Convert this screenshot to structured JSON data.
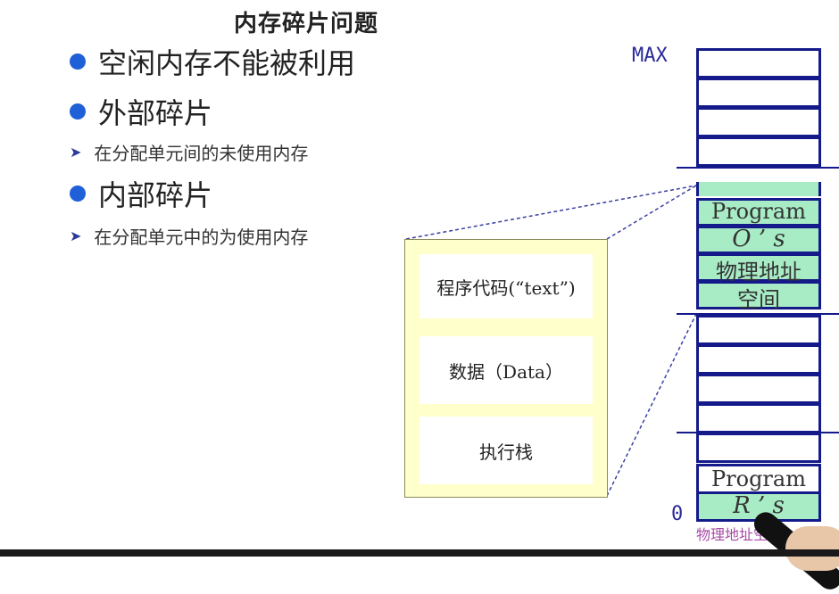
{
  "slide": {
    "title": "内存碎片问题",
    "bullets": [
      {
        "text": "空闲内存不能被利用"
      },
      {
        "text": "外部碎片"
      },
      {
        "text": "内部碎片"
      }
    ],
    "subs": [
      {
        "text": "在分配单元间的未使用内存"
      },
      {
        "text": "在分配单元中的为使用内存"
      }
    ]
  },
  "memory": {
    "max_label": "MAX",
    "zero_label": "0",
    "os_program": "Program",
    "os_os": "O ’ s",
    "os_phys1": "物理地址",
    "os_phys2": "空间",
    "r_program": "Program",
    "r_rs": "R ’ s",
    "bottom_caption": "物理地址空间"
  },
  "process": {
    "text_seg": "程序代码(“text”)",
    "data_seg": "数据（Data）",
    "stack_seg": "执行栈"
  },
  "colors": {
    "accent_blue": "#141a8a",
    "bullet_blue": "#1f5fd8",
    "segment_green": "#a8ecc6",
    "process_yellow": "#ffffcc"
  }
}
